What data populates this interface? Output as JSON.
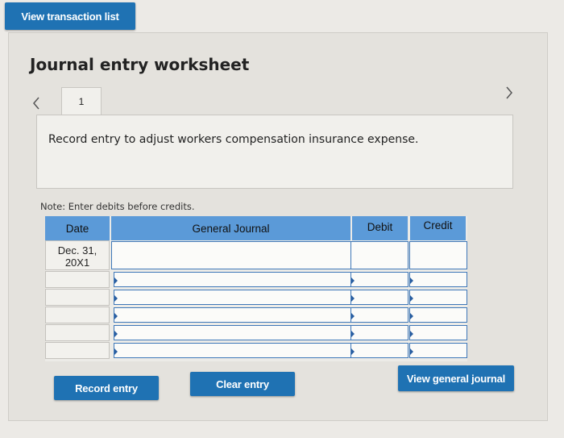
{
  "top_button": {
    "label": "View transaction list"
  },
  "worksheet": {
    "title": "Journal entry worksheet",
    "tabs": [
      {
        "label": "1"
      }
    ],
    "instruction": "Record entry to adjust workers compensation insurance expense.",
    "note": "Note: Enter debits before credits."
  },
  "table": {
    "headers": {
      "date": "Date",
      "general_journal": "General Journal",
      "debit": "Debit",
      "credit": "Credit"
    },
    "rows": [
      {
        "date": "Dec. 31,\n20X1"
      },
      {
        "date": ""
      },
      {
        "date": ""
      },
      {
        "date": ""
      },
      {
        "date": ""
      },
      {
        "date": ""
      }
    ]
  },
  "buttons": {
    "record": "Record entry",
    "clear": "Clear entry",
    "view_general_journal": "View general journal"
  },
  "colors": {
    "button": "#1f72b3",
    "header": "#5b9ad8",
    "input_border": "#3f78b9"
  },
  "icons": {
    "prev": "chevron-left-icon",
    "next": "chevron-right-icon"
  }
}
